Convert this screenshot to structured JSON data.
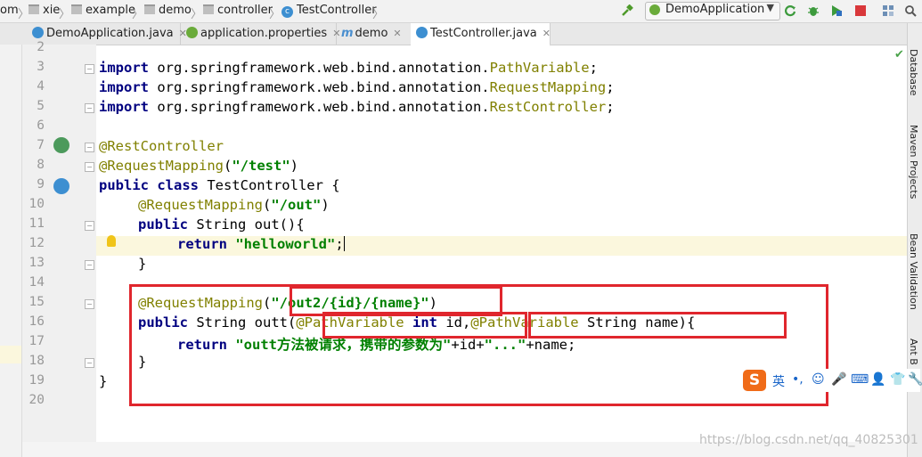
{
  "breadcrumb": {
    "items": [
      {
        "label": "om"
      },
      {
        "label": "xie"
      },
      {
        "label": "example"
      },
      {
        "label": "demo"
      },
      {
        "label": "controller"
      },
      {
        "label": "TestController"
      }
    ]
  },
  "toolbar": {
    "run_config": "DemoApplication"
  },
  "tabs": [
    {
      "label": "DemoApplication.java",
      "icon": "class-icon"
    },
    {
      "label": "application.properties",
      "icon": "spring-config-icon"
    },
    {
      "label": "demo",
      "icon": "maven-icon"
    },
    {
      "label": "TestController.java",
      "icon": "class-icon",
      "active": true
    }
  ],
  "editor": {
    "line_numbers": [
      "2",
      "3",
      "4",
      "5",
      "6",
      "7",
      "8",
      "9",
      "10",
      "11",
      "12",
      "13",
      "14",
      "15",
      "16",
      "17",
      "18",
      "19",
      "20"
    ]
  },
  "code": {
    "l3_kw": "import",
    "l3_rest": " org.springframework.web.bind.annotation.",
    "l3_cls": "PathVariable",
    "l3_end": ";",
    "l4_kw": "import",
    "l4_rest": " org.springframework.web.bind.annotation.",
    "l4_cls": "RequestMapping",
    "l4_end": ";",
    "l5_kw": "import",
    "l5_rest": " org.springframework.web.bind.annotation.",
    "l5_cls": "RestController",
    "l5_end": ";",
    "l7_ann": "@RestController",
    "l8_ann": "@RequestMapping",
    "l8_p1": "(",
    "l8_str": "\"/test\"",
    "l8_p2": ")",
    "l9_kw": "public class",
    "l9_rest": " TestController {",
    "l10_ann": "@RequestMapping",
    "l10_p1": "(",
    "l10_str": "\"/out\"",
    "l10_p2": ")",
    "l11_kw": "public",
    "l11_rest": " String out(){",
    "l12_kw": "return",
    "l12_sp": " ",
    "l12_str": "\"helloworld\"",
    "l12_end": ";",
    "l13": "}",
    "l15_ann": "@RequestMapping",
    "l15_p1": "(",
    "l15_str": "\"/out2/{id}/{name}\"",
    "l15_p2": ")",
    "l16_kw": "public",
    "l16_a": " String outt(",
    "l16_ann1": "@PathVariable",
    "l16_sp": " ",
    "l16_kw2": "int",
    "l16_b": " id,",
    "l16_ann2": "@PathVariable",
    "l16_c": " String name){",
    "l17_kw": "return",
    "l17_sp": " ",
    "l17_str1": "\"outt方法被请求，携带的参数为\"",
    "l17_a": "+id+",
    "l17_str2": "\"...\"",
    "l17_b": "+name;",
    "l18": "}",
    "l19": "}"
  },
  "right_panel": {
    "database": "Database",
    "maven": "Maven Projects",
    "bean": "Bean Validation",
    "ant": "Ant B"
  },
  "ime_bar": {
    "logo": "S",
    "lang": "英",
    "punct": "•,"
  },
  "watermark": "https://blog.csdn.net/qq_40825301",
  "colors": {
    "keyword": "#000080",
    "annotation": "#808000",
    "string": "#008000",
    "highlight_box": "#e0262d",
    "current_line": "#fbf7dd"
  }
}
